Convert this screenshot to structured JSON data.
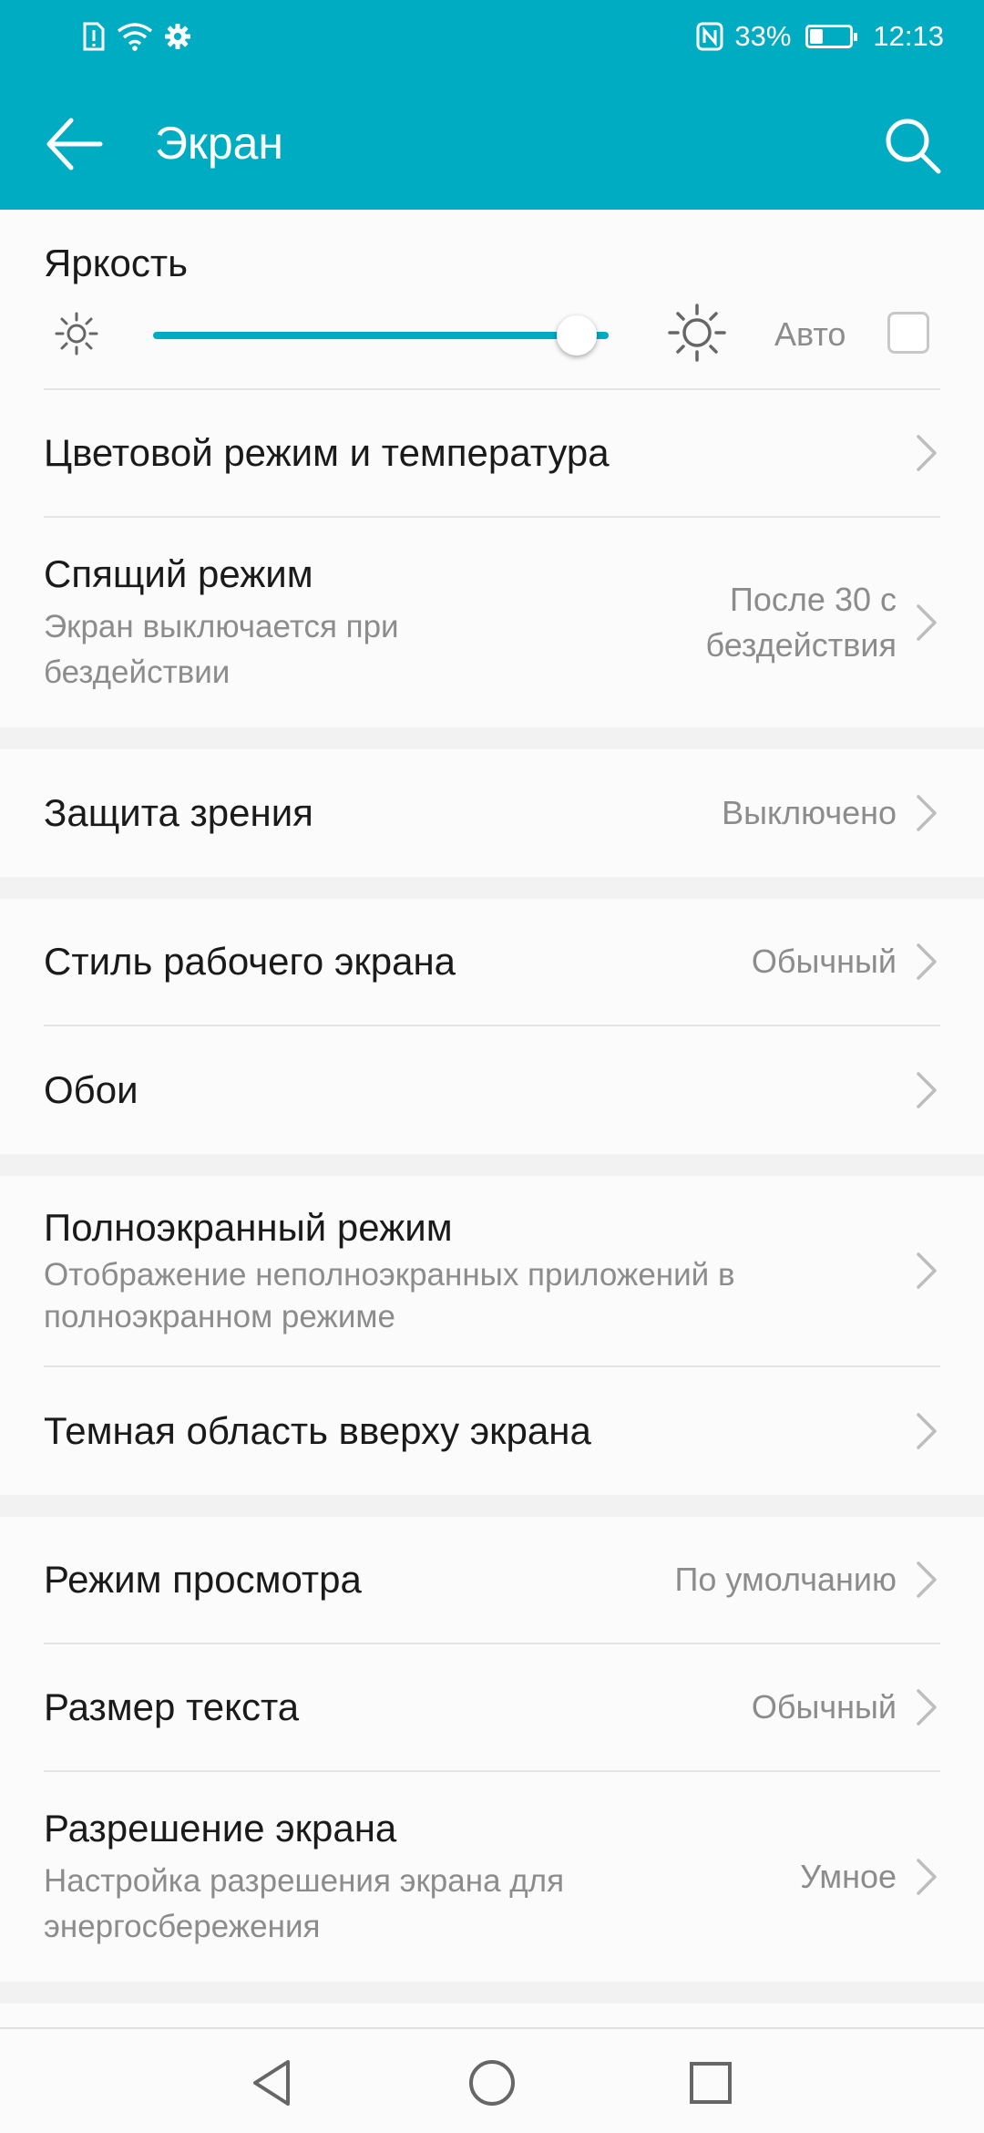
{
  "status_bar": {
    "battery_percent": "33%",
    "battery_level": 0.33,
    "time": "12:13",
    "left_icons": [
      "sim-alert-icon",
      "wifi-icon",
      "gear-icon"
    ],
    "right_icons": [
      "nfc-icon",
      "battery-icon"
    ]
  },
  "app_bar": {
    "title": "Экран",
    "back_icon": "arrow-left-icon",
    "search_icon": "search-icon",
    "color": "#00acc1"
  },
  "brightness": {
    "title": "Яркость",
    "level": 0.93,
    "auto_label": "Авто",
    "auto_checked": false
  },
  "sections": [
    [
      {
        "title": "Цветовой режим и температура",
        "subtitle": "",
        "value": ""
      },
      {
        "title": "Спящий режим",
        "subtitle": "Экран выключается при бездействии",
        "value": "После 30 с бездействия"
      }
    ],
    [
      {
        "title": "Защита зрения",
        "subtitle": "",
        "value": "Выключено"
      }
    ],
    [
      {
        "title": "Стиль рабочего экрана",
        "subtitle": "",
        "value": "Обычный"
      },
      {
        "title": "Обои",
        "subtitle": "",
        "value": ""
      }
    ],
    [
      {
        "title": "Полноэкранный режим",
        "subtitle": "Отображение неполноэкранных приложений в полноэкранном режиме",
        "value": ""
      },
      {
        "title": "Темная область вверху экрана",
        "subtitle": "",
        "value": ""
      }
    ],
    [
      {
        "title": "Режим просмотра",
        "subtitle": "",
        "value": "По умолчанию"
      },
      {
        "title": "Размер текста",
        "subtitle": "",
        "value": "Обычный"
      },
      {
        "title": "Разрешение экрана",
        "subtitle": "Настройка разрешения экрана для энергосбережения",
        "value": "Умное"
      }
    ]
  ],
  "nav_bar": {
    "icons": [
      "back-triangle-icon",
      "home-circle-icon",
      "recents-square-icon"
    ]
  }
}
